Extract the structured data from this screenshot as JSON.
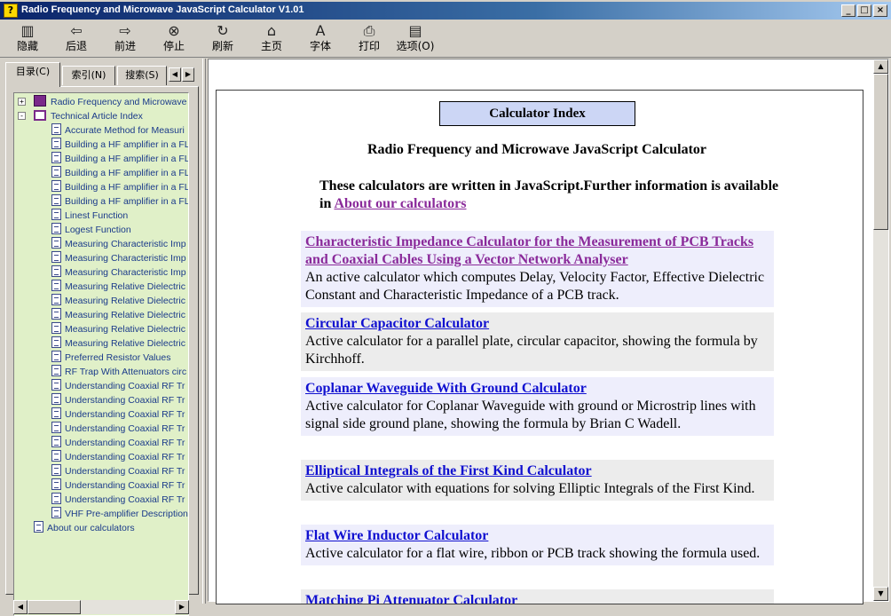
{
  "window": {
    "title": "Radio Frequency and Microwave JavaScript Calculator V1.01",
    "app_icon": "help-question-icon",
    "controls": [
      "minimize-icon",
      "maximize-icon",
      "close-icon"
    ]
  },
  "toolbar": [
    {
      "id": "hide",
      "label": "隐藏",
      "icon": "hide-pane-icon"
    },
    {
      "id": "back",
      "label": "后退",
      "icon": "back-arrow-icon"
    },
    {
      "id": "forward",
      "label": "前进",
      "icon": "forward-arrow-icon"
    },
    {
      "id": "stop",
      "label": "停止",
      "icon": "stop-icon"
    },
    {
      "id": "refresh",
      "label": "刷新",
      "icon": "refresh-icon"
    },
    {
      "id": "home",
      "label": "主页",
      "icon": "home-icon"
    },
    {
      "id": "font",
      "label": "字体",
      "icon": "font-icon"
    },
    {
      "id": "print",
      "label": "打印",
      "icon": "print-icon"
    },
    {
      "id": "options",
      "label": "选项(O)",
      "icon": "options-icon"
    }
  ],
  "nav": {
    "tabs": [
      {
        "label": "目录(C)",
        "active": true
      },
      {
        "label": "索引(N)",
        "active": false
      },
      {
        "label": "搜索(S)",
        "active": false
      }
    ],
    "tree": [
      {
        "label": "Radio Frequency and Microwave",
        "level": 0,
        "type": "book",
        "expander": "+"
      },
      {
        "label": "Technical Article Index",
        "level": 0,
        "type": "book-open",
        "expander": "-"
      },
      {
        "label": "Accurate Method for Measuri",
        "level": 1,
        "type": "page"
      },
      {
        "label": "Building a HF amplifier in a FL",
        "level": 1,
        "type": "page"
      },
      {
        "label": "Building a HF amplifier in a FL",
        "level": 1,
        "type": "page"
      },
      {
        "label": "Building a HF amplifier in a FL",
        "level": 1,
        "type": "page"
      },
      {
        "label": "Building a HF amplifier in a FL",
        "level": 1,
        "type": "page"
      },
      {
        "label": "Building a HF amplifier in a FL",
        "level": 1,
        "type": "page"
      },
      {
        "label": "Linest Function",
        "level": 1,
        "type": "page"
      },
      {
        "label": "Logest Function",
        "level": 1,
        "type": "page"
      },
      {
        "label": "Measuring Characteristic Imp",
        "level": 1,
        "type": "page"
      },
      {
        "label": "Measuring Characteristic Imp",
        "level": 1,
        "type": "page"
      },
      {
        "label": "Measuring Characteristic Imp",
        "level": 1,
        "type": "page"
      },
      {
        "label": "Measuring Relative Dielectric",
        "level": 1,
        "type": "page"
      },
      {
        "label": "Measuring Relative Dielectric",
        "level": 1,
        "type": "page"
      },
      {
        "label": "Measuring Relative Dielectric",
        "level": 1,
        "type": "page"
      },
      {
        "label": "Measuring Relative Dielectric",
        "level": 1,
        "type": "page"
      },
      {
        "label": "Measuring Relative Dielectric",
        "level": 1,
        "type": "page"
      },
      {
        "label": "Preferred Resistor Values",
        "level": 1,
        "type": "page"
      },
      {
        "label": "RF Trap With Attenuators circ",
        "level": 1,
        "type": "page"
      },
      {
        "label": "Understanding Coaxial RF Tr",
        "level": 1,
        "type": "page"
      },
      {
        "label": "Understanding Coaxial RF Tr",
        "level": 1,
        "type": "page"
      },
      {
        "label": "Understanding Coaxial RF Tr",
        "level": 1,
        "type": "page"
      },
      {
        "label": "Understanding Coaxial RF Tr",
        "level": 1,
        "type": "page"
      },
      {
        "label": "Understanding Coaxial RF Tr",
        "level": 1,
        "type": "page"
      },
      {
        "label": "Understanding Coaxial RF Tr",
        "level": 1,
        "type": "page"
      },
      {
        "label": "Understanding Coaxial RF Tr",
        "level": 1,
        "type": "page"
      },
      {
        "label": "Understanding Coaxial RF Tr",
        "level": 1,
        "type": "page"
      },
      {
        "label": "Understanding Coaxial RF Tr",
        "level": 1,
        "type": "page"
      },
      {
        "label": "VHF Pre-amplifier Description",
        "level": 1,
        "type": "page"
      },
      {
        "label": "About our calculators",
        "level": 0,
        "type": "page"
      }
    ]
  },
  "document": {
    "index_title": "Calculator Index",
    "subtitle": "Radio Frequency and Microwave JavaScript Calculator",
    "intro_text": "These calculators are written in JavaScript.Further information is available in",
    "intro_link": "About our calculators",
    "entries": [
      {
        "name": "Characteristic Impedance Calculator for the Measurement of PCB Tracks and Coaxial Cables Using a Vector Network Analyser",
        "desc": "An active calculator which computes Delay, Velocity Factor, Effective Dielectric Constant and Characteristic Impedance of a PCB track.",
        "visited": true,
        "bg": "#eeeefc"
      },
      {
        "name": "Circular Capacitor Calculator",
        "desc": "Active calculator for a parallel plate, circular capacitor, showing the formula by Kirchhoff.",
        "visited": false,
        "bg": "#ececec"
      },
      {
        "name": "Coplanar Waveguide With Ground Calculator",
        "desc": "Active calculator for Coplanar Waveguide with ground or Microstrip lines with signal side ground plane, showing the formula by Brian C Wadell.",
        "visited": false,
        "bg": "#eeeefc"
      },
      {
        "name": "Elliptical Integrals of the First Kind Calculator",
        "desc": "Active calculator with equations for solving Elliptic Integrals of the First Kind.",
        "visited": false,
        "bg": "#ececec"
      },
      {
        "name": "Flat Wire Inductor Calculator",
        "desc": "Active calculator for a flat wire, ribbon or PCB track showing the formula used.",
        "visited": false,
        "bg": "#eeeefc"
      },
      {
        "name": "Matching Pi Attenuator Calculator",
        "desc": "",
        "visited": false,
        "bg": "#ececec"
      }
    ]
  }
}
